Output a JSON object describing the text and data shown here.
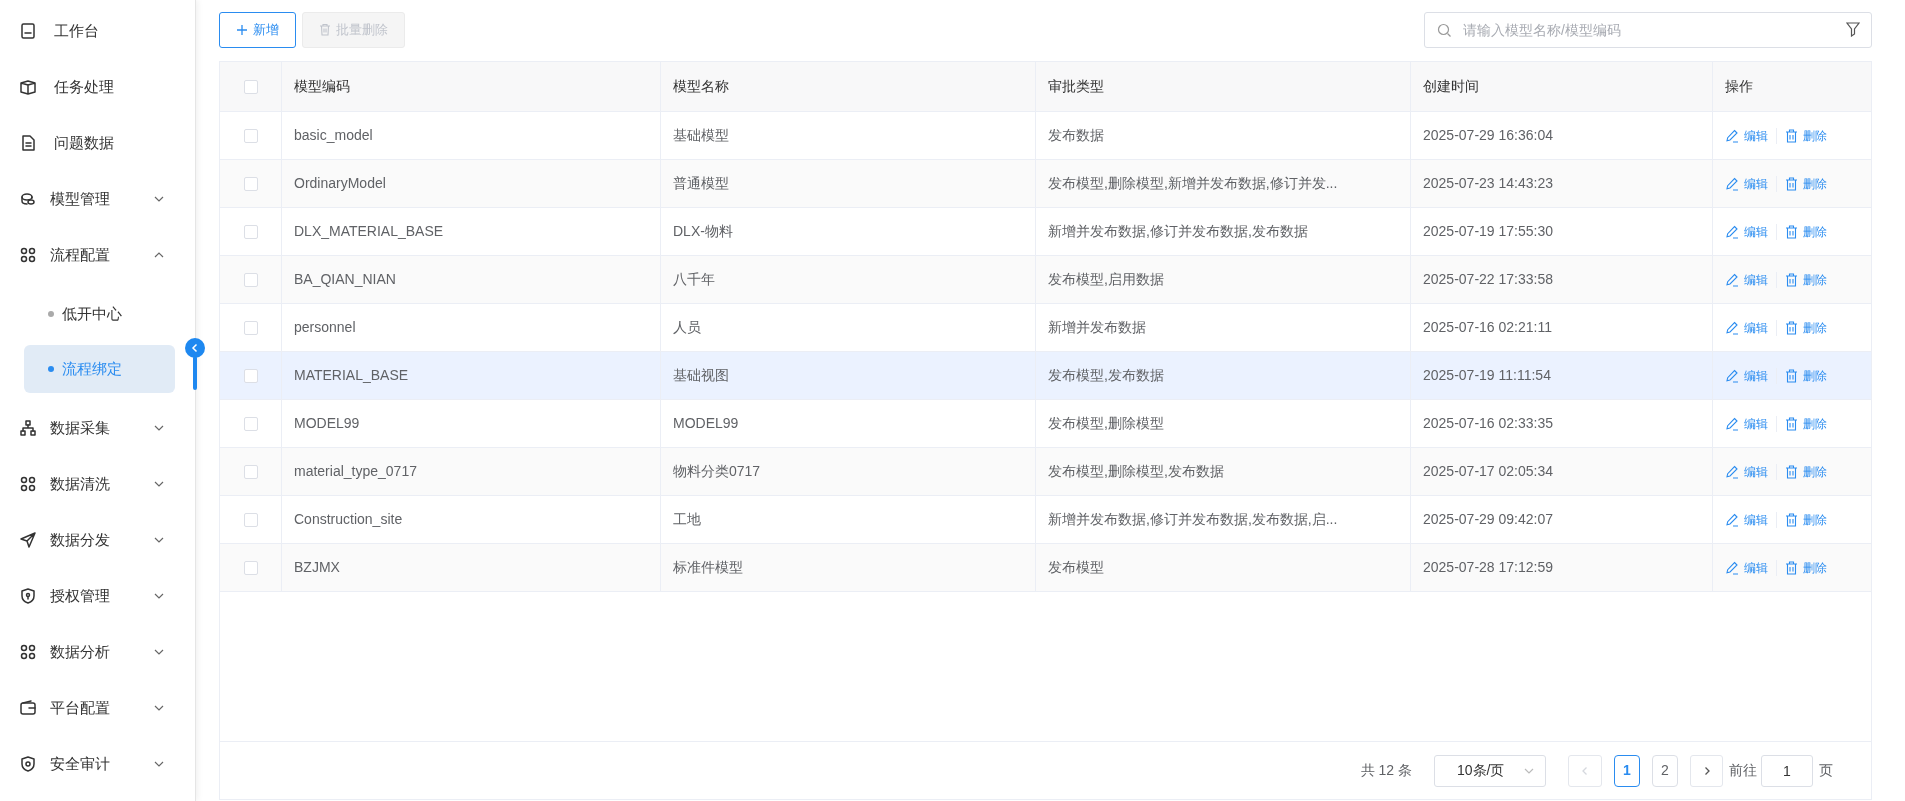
{
  "sidebar": {
    "items": [
      {
        "label": "工作台"
      },
      {
        "label": "任务处理"
      },
      {
        "label": "问题数据"
      },
      {
        "label": "模型管理",
        "expanded": false
      },
      {
        "label": "流程配置",
        "expanded": true,
        "children": [
          {
            "label": "低开中心",
            "selected": false
          },
          {
            "label": "流程绑定",
            "selected": true
          }
        ]
      },
      {
        "label": "数据采集",
        "expanded": false
      },
      {
        "label": "数据清洗",
        "expanded": false
      },
      {
        "label": "数据分发",
        "expanded": false
      },
      {
        "label": "授权管理",
        "expanded": false
      },
      {
        "label": "数据分析",
        "expanded": false
      },
      {
        "label": "平台配置",
        "expanded": false
      },
      {
        "label": "安全审计",
        "expanded": false
      }
    ]
  },
  "toolbar": {
    "add_button": "新增",
    "batch_delete_button": {
      "label": "批量删除",
      "disabled": true
    },
    "search": {
      "placeholder": "请输入模型名称/模型编码"
    }
  },
  "table": {
    "header_checked": false,
    "columns": [
      "模型编码",
      "模型名称",
      "审批类型",
      "创建时间",
      "操作"
    ],
    "rows": [
      {
        "checked": false,
        "highlighted": false,
        "cells": [
          "basic_model",
          "基础模型",
          "发布数据",
          "2025-07-29 16:36:04"
        ],
        "actions": [
          "编辑",
          "删除"
        ]
      },
      {
        "checked": false,
        "highlighted": false,
        "cells": [
          "OrdinaryModel",
          "普通模型",
          "发布模型,删除模型,新增并发布数据,修订并发...",
          "2025-07-23 14:43:23"
        ],
        "actions": [
          "编辑",
          "删除"
        ]
      },
      {
        "checked": false,
        "highlighted": false,
        "cells": [
          "DLX_MATERIAL_BASE",
          "DLX-物料",
          "新增并发布数据,修订并发布数据,发布数据",
          "2025-07-19 17:55:30"
        ],
        "actions": [
          "编辑",
          "删除"
        ]
      },
      {
        "checked": false,
        "highlighted": false,
        "cells": [
          "BA_QIAN_NIAN",
          "八千年",
          "发布模型,启用数据",
          "2025-07-22 17:33:58"
        ],
        "actions": [
          "编辑",
          "删除"
        ]
      },
      {
        "checked": false,
        "highlighted": false,
        "cells": [
          "personnel",
          "人员",
          "新增并发布数据",
          "2025-07-16 02:21:11"
        ],
        "actions": [
          "编辑",
          "删除"
        ]
      },
      {
        "checked": false,
        "highlighted": true,
        "cells": [
          "MATERIAL_BASE",
          "基础视图",
          "发布模型,发布数据",
          "2025-07-19 11:11:54"
        ],
        "actions": [
          "编辑",
          "删除"
        ]
      },
      {
        "checked": false,
        "highlighted": false,
        "cells": [
          "MODEL99",
          "MODEL99",
          "发布模型,删除模型",
          "2025-07-16 02:33:35"
        ],
        "actions": [
          "编辑",
          "删除"
        ]
      },
      {
        "checked": false,
        "highlighted": false,
        "cells": [
          "material_type_0717",
          "物料分类0717",
          "发布模型,删除模型,发布数据",
          "2025-07-17 02:05:34"
        ],
        "actions": [
          "编辑",
          "删除"
        ]
      },
      {
        "checked": false,
        "highlighted": false,
        "cells": [
          "Construction_site",
          "工地",
          "新增并发布数据,修订并发布数据,发布数据,启...",
          "2025-07-29 09:42:07"
        ],
        "actions": [
          "编辑",
          "删除"
        ]
      },
      {
        "checked": false,
        "highlighted": false,
        "cells": [
          "BZJMX",
          "标准件模型",
          "发布模型",
          "2025-07-28 17:12:59"
        ],
        "actions": [
          "编辑",
          "删除"
        ]
      }
    ]
  },
  "pagination": {
    "total": "共 12 条",
    "page_size": "10条/页",
    "prev_disabled": true,
    "next_disabled": false,
    "pages": [
      {
        "label": "1",
        "selected": true
      },
      {
        "label": "2",
        "selected": false
      }
    ],
    "goto_label": "前往",
    "goto_value": "1",
    "goto_suffix": "页"
  }
}
